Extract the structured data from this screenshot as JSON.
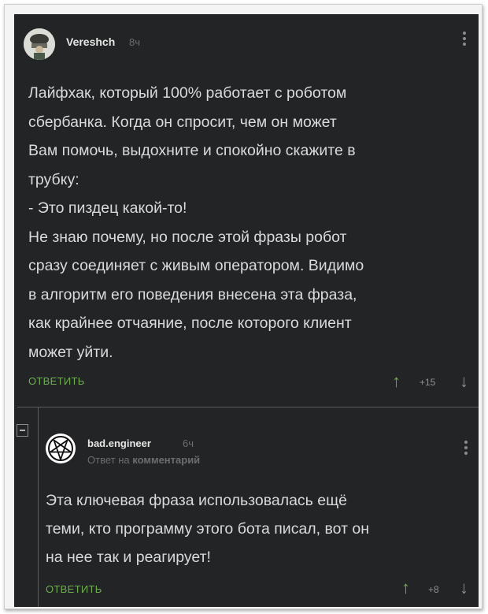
{
  "comment": {
    "username": "Vereshch",
    "time": "8ч",
    "lines": [
      "Лайфхак, который 100% работает с роботом",
      "сбербанка. Когда он спросит, чем он может",
      "Вам помочь, выдохните и спокойно скажите в",
      "трубку:",
      "- Это пиздец какой-то!",
      "Не знаю почему, но после этой фразы робот",
      "сразу соединяет с живым оператором. Видимо",
      "в алгоритм его поведения внесена эта фраза,",
      "как крайнее отчаяние, после которого клиент",
      "может уйти."
    ],
    "reply_label": "ОТВЕТИТЬ",
    "rating": "+15",
    "up_icon": "↑",
    "down_icon": "↓"
  },
  "reply": {
    "username": "bad.engineer",
    "time": "6ч",
    "reply_to_prefix": "Ответ на",
    "reply_to_target": "комментарий",
    "lines": [
      "Эта ключевая фраза использовалась ещё",
      "теми, кто программу этого бота писал, вот он",
      "на нее так и реагирует!"
    ],
    "reply_label": "ОТВЕТИТЬ",
    "rating": "+8",
    "up_icon": "↑",
    "down_icon": "↓"
  },
  "colors": {
    "background": "#232425",
    "text": "#d9dadb",
    "accent_green": "#6fae4f",
    "muted": "#6b6d6f"
  }
}
